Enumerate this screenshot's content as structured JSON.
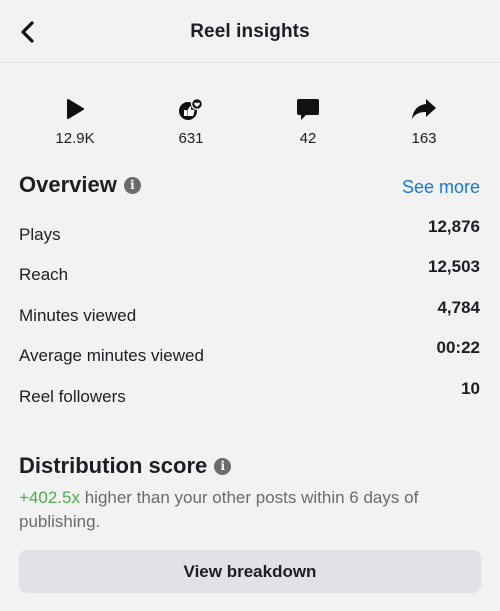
{
  "header": {
    "title": "Reel insights"
  },
  "stats": [
    {
      "icon": "play-icon",
      "value": "12.9K"
    },
    {
      "icon": "like-heart-reaction-icon",
      "value": "631"
    },
    {
      "icon": "comment-icon",
      "value": "42"
    },
    {
      "icon": "share-icon",
      "value": "163"
    }
  ],
  "overview": {
    "title": "Overview",
    "see_more": "See more",
    "rows": [
      {
        "label": "Plays",
        "value": "12,876"
      },
      {
        "label": "Reach",
        "value": "12,503"
      },
      {
        "label": "Minutes viewed",
        "value": "4,784"
      },
      {
        "label": "Average minutes viewed",
        "value": "00:22"
      },
      {
        "label": "Reel followers",
        "value": "10"
      }
    ]
  },
  "distribution": {
    "title": "Distribution score",
    "highlight": "+402.5x",
    "text": " higher than your other posts within 6 days of publishing.",
    "button": "View breakdown"
  },
  "colors": {
    "link": "#1877d9",
    "positive": "#4cae4f",
    "button_bg": "#e1e1e6"
  }
}
